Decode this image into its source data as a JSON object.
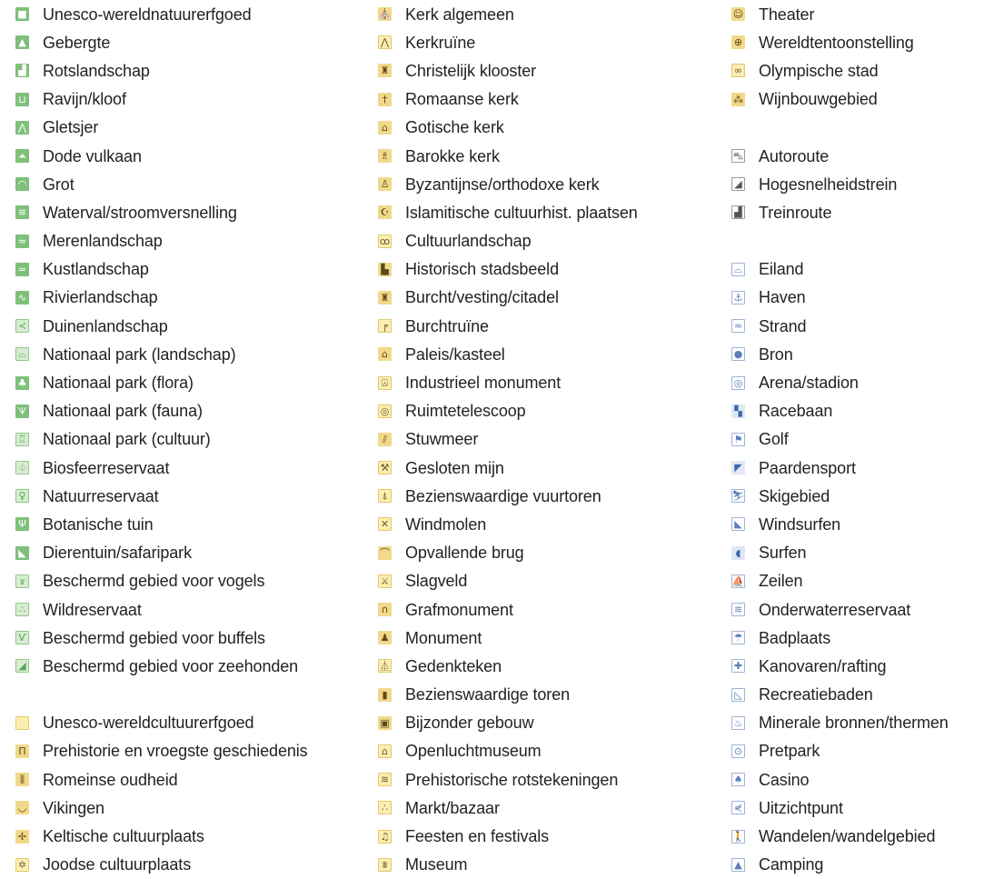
{
  "columns": [
    {
      "id": "col-1",
      "items": [
        {
          "label": "Unesco-wereldnatuurerfgoed",
          "icon": "square-icon"
        },
        {
          "label": "Gebergte",
          "icon": "mountain-icon"
        },
        {
          "label": "Rotslandschap",
          "icon": "rocks-icon"
        },
        {
          "label": "Ravijn/kloof",
          "icon": "canyon-icon"
        },
        {
          "label": "Gletsjer",
          "icon": "glacier-icon"
        },
        {
          "label": "Dode vulkaan",
          "icon": "volcano-icon"
        },
        {
          "label": "Grot",
          "icon": "cave-icon"
        },
        {
          "label": "Waterval/stroomversnelling",
          "icon": "waterfall-icon"
        },
        {
          "label": "Merenlandschap",
          "icon": "lake-icon"
        },
        {
          "label": "Kustlandschap",
          "icon": "coast-icon"
        },
        {
          "label": "Rivierlandschap",
          "icon": "river-icon"
        },
        {
          "label": "Duinenlandschap",
          "icon": "dunes-icon"
        },
        {
          "label": "Nationaal park (landschap)",
          "icon": "park-landscape-icon"
        },
        {
          "label": "Nationaal park (flora)",
          "icon": "tree-icon"
        },
        {
          "label": "Nationaal park (fauna)",
          "icon": "bird-icon"
        },
        {
          "label": "Nationaal park (cultuur)",
          "icon": "park-culture-icon"
        },
        {
          "label": "Biosfeerreservaat",
          "icon": "biosphere-icon"
        },
        {
          "label": "Natuurreservaat",
          "icon": "nature-reserve-icon"
        },
        {
          "label": "Botanische tuin",
          "icon": "plant-icon"
        },
        {
          "label": "Dierentuin/safaripark",
          "icon": "animal-icon"
        },
        {
          "label": "Beschermd gebied voor vogels",
          "icon": "stork-icon"
        },
        {
          "label": "Wildreservaat",
          "icon": "paw-icon"
        },
        {
          "label": "Beschermd gebied voor buffels",
          "icon": "buffalo-icon"
        },
        {
          "label": "Beschermd gebied voor zeehonden",
          "icon": "seal-icon"
        },
        {
          "label": "",
          "icon": ""
        },
        {
          "label": "Unesco-wereldcultuurerfgoed",
          "icon": "square-icon"
        },
        {
          "label": "Prehistorie en vroegste geschiedenis",
          "icon": "dolmen-icon"
        },
        {
          "label": "Romeinse oudheid",
          "icon": "columns-icon"
        },
        {
          "label": "Vikingen",
          "icon": "viking-ship-icon"
        },
        {
          "label": "Keltische cultuurplaats",
          "icon": "celtic-cross-icon"
        },
        {
          "label": "Joodse cultuurplaats",
          "icon": "star-of-david-icon"
        }
      ]
    },
    {
      "id": "col-2",
      "items": [
        {
          "label": "Kerk algemeen",
          "icon": "church-icon"
        },
        {
          "label": "Kerkruïne",
          "icon": "church-ruin-icon"
        },
        {
          "label": "Christelijk klooster",
          "icon": "monastery-icon"
        },
        {
          "label": "Romaanse kerk",
          "icon": "romanesque-church-icon"
        },
        {
          "label": "Gotische kerk",
          "icon": "gothic-church-icon"
        },
        {
          "label": "Barokke kerk",
          "icon": "baroque-church-icon"
        },
        {
          "label": "Byzantijnse/orthodoxe kerk",
          "icon": "orthodox-church-icon"
        },
        {
          "label": "Islamitische cultuurhist. plaatsen",
          "icon": "crescent-icon"
        },
        {
          "label": "Cultuurlandschap",
          "icon": "cultural-landscape-icon"
        },
        {
          "label": "Historisch stadsbeeld",
          "icon": "townscape-icon"
        },
        {
          "label": "Burcht/vesting/citadel",
          "icon": "castle-icon"
        },
        {
          "label": "Burchtruïne",
          "icon": "castle-ruin-icon"
        },
        {
          "label": "Paleis/kasteel",
          "icon": "palace-icon"
        },
        {
          "label": "Industrieel monument",
          "icon": "industrial-icon"
        },
        {
          "label": "Ruimtetelescoop",
          "icon": "telescope-icon"
        },
        {
          "label": "Stuwmeer",
          "icon": "dam-icon"
        },
        {
          "label": "Gesloten mijn",
          "icon": "mine-icon"
        },
        {
          "label": "Bezienswaardige vuurtoren",
          "icon": "lighthouse-icon"
        },
        {
          "label": "Windmolen",
          "icon": "windmill-icon"
        },
        {
          "label": "Opvallende brug",
          "icon": "bridge-icon"
        },
        {
          "label": "Slagveld",
          "icon": "battlefield-icon"
        },
        {
          "label": "Grafmonument",
          "icon": "tomb-icon"
        },
        {
          "label": "Monument",
          "icon": "monument-icon"
        },
        {
          "label": "Gedenkteken",
          "icon": "memorial-icon"
        },
        {
          "label": "Bezienswaardige toren",
          "icon": "tower-icon"
        },
        {
          "label": "Bijzonder gebouw",
          "icon": "building-icon"
        },
        {
          "label": "Openluchtmuseum",
          "icon": "open-air-museum-icon"
        },
        {
          "label": "Prehistorische rotstekeningen",
          "icon": "rock-art-icon"
        },
        {
          "label": "Markt/bazaar",
          "icon": "market-icon"
        },
        {
          "label": "Feesten en festivals",
          "icon": "music-note-icon"
        },
        {
          "label": "Museum",
          "icon": "museum-icon"
        }
      ]
    },
    {
      "id": "col-3",
      "items": [
        {
          "label": "Theater",
          "icon": "theater-icon"
        },
        {
          "label": "Wereldtentoonstelling",
          "icon": "globe-icon"
        },
        {
          "label": "Olympische stad",
          "icon": "olympic-rings-icon"
        },
        {
          "label": "Wijnbouwgebied",
          "icon": "grapes-icon"
        },
        {
          "label": "",
          "icon": ""
        },
        {
          "label": "Autoroute",
          "icon": "car-icon"
        },
        {
          "label": "Hogesnelheidstrein",
          "icon": "high-speed-train-icon"
        },
        {
          "label": "Treinroute",
          "icon": "train-icon"
        },
        {
          "label": "",
          "icon": ""
        },
        {
          "label": "Eiland",
          "icon": "island-icon"
        },
        {
          "label": "Haven",
          "icon": "anchor-icon"
        },
        {
          "label": "Strand",
          "icon": "beach-icon"
        },
        {
          "label": "Bron",
          "icon": "spring-icon"
        },
        {
          "label": "Arena/stadion",
          "icon": "stadium-icon"
        },
        {
          "label": "Racebaan",
          "icon": "checkered-flag-icon"
        },
        {
          "label": "Golf",
          "icon": "golf-icon"
        },
        {
          "label": "Paardensport",
          "icon": "horse-icon"
        },
        {
          "label": "Skigebied",
          "icon": "ski-icon"
        },
        {
          "label": "Windsurfen",
          "icon": "windsurf-icon"
        },
        {
          "label": "Surfen",
          "icon": "wave-icon"
        },
        {
          "label": "Zeilen",
          "icon": "sailboat-icon"
        },
        {
          "label": "Onderwaterreservaat",
          "icon": "underwater-icon"
        },
        {
          "label": "Badplaats",
          "icon": "beach-umbrella-icon"
        },
        {
          "label": "Kanovaren/rafting",
          "icon": "canoe-icon"
        },
        {
          "label": "Recreatiebaden",
          "icon": "pool-icon"
        },
        {
          "label": "Minerale bronnen/thermen",
          "icon": "thermal-icon"
        },
        {
          "label": "Pretpark",
          "icon": "amusement-park-icon"
        },
        {
          "label": "Casino",
          "icon": "spade-icon"
        },
        {
          "label": "Uitzichtpunt",
          "icon": "viewpoint-icon"
        },
        {
          "label": "Wandelen/wandelgebied",
          "icon": "hiking-icon"
        },
        {
          "label": "Camping",
          "icon": "tent-icon"
        }
      ]
    }
  ]
}
